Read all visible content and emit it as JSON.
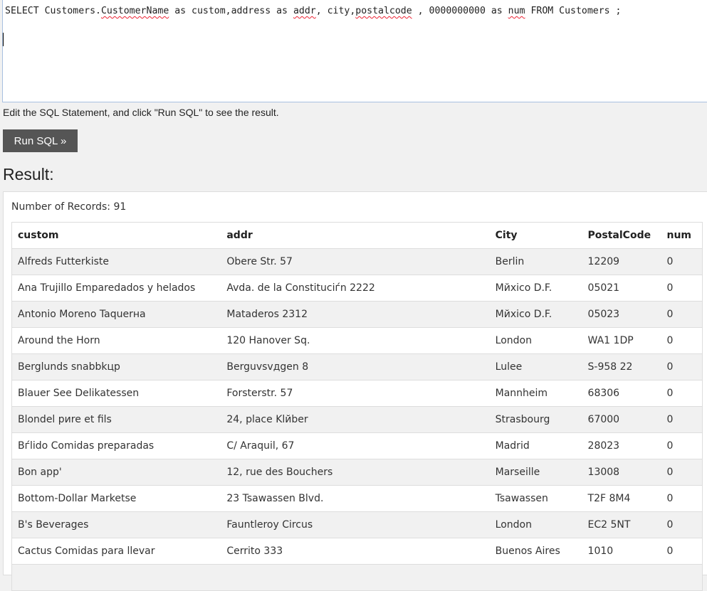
{
  "editor": {
    "segments": [
      {
        "text": "SELECT Customers.",
        "sq": false
      },
      {
        "text": "CustomerName",
        "sq": true
      },
      {
        "text": " as custom,address as ",
        "sq": false
      },
      {
        "text": "addr",
        "sq": true
      },
      {
        "text": ", city,",
        "sq": false
      },
      {
        "text": "postalcode",
        "sq": true
      },
      {
        "text": " , 0000000000 as ",
        "sq": false
      },
      {
        "text": "num",
        "sq": true
      },
      {
        "text": " FROM Customers ;",
        "sq": false
      }
    ]
  },
  "hint": "Edit the SQL Statement, and click \"Run SQL\" to see the result.",
  "run_button": "Run SQL »",
  "result_title": "Result:",
  "record_count": "Number of Records: 91",
  "table": {
    "columns": [
      "custom",
      "addr",
      "City",
      "PostalCode",
      "num"
    ],
    "rows": [
      [
        "Alfreds Futterkiste",
        "Obere Str. 57",
        "Berlin",
        "12209",
        "0"
      ],
      [
        "Ana Trujillo Emparedados y helados",
        "Avda. de la Constituciѓn 2222",
        "Mйxico D.F.",
        "05021",
        "0"
      ],
      [
        "Antonio Moreno Taquerнa",
        "Mataderos 2312",
        "Mйxico D.F.",
        "05023",
        "0"
      ],
      [
        "Around the Horn",
        "120 Hanover Sq.",
        "London",
        "WA1 1DP",
        "0"
      ],
      [
        "Berglunds snabbkцp",
        "Berguvsvдgen 8",
        "Luleе",
        "S-958 22",
        "0"
      ],
      [
        "Blauer See Delikatessen",
        "Forsterstr. 57",
        "Mannheim",
        "68306",
        "0"
      ],
      [
        "Blondel pиre et fils",
        "24, place Klйber",
        "Strasbourg",
        "67000",
        "0"
      ],
      [
        "Bѓlido Comidas preparadas",
        "C/ Araquil, 67",
        "Madrid",
        "28023",
        "0"
      ],
      [
        "Bon app'",
        "12, rue des Bouchers",
        "Marseille",
        "13008",
        "0"
      ],
      [
        "Bottom-Dollar Marketse",
        "23 Tsawassen Blvd.",
        "Tsawassen",
        "T2F 8M4",
        "0"
      ],
      [
        "B's Beverages",
        "Fauntleroy Circus",
        "London",
        "EC2 5NT",
        "0"
      ],
      [
        "Cactus Comidas para llevar",
        "Cerrito 333",
        "Buenos Aires",
        "1010",
        "0"
      ],
      [
        "",
        "",
        "",
        "",
        ""
      ]
    ]
  }
}
